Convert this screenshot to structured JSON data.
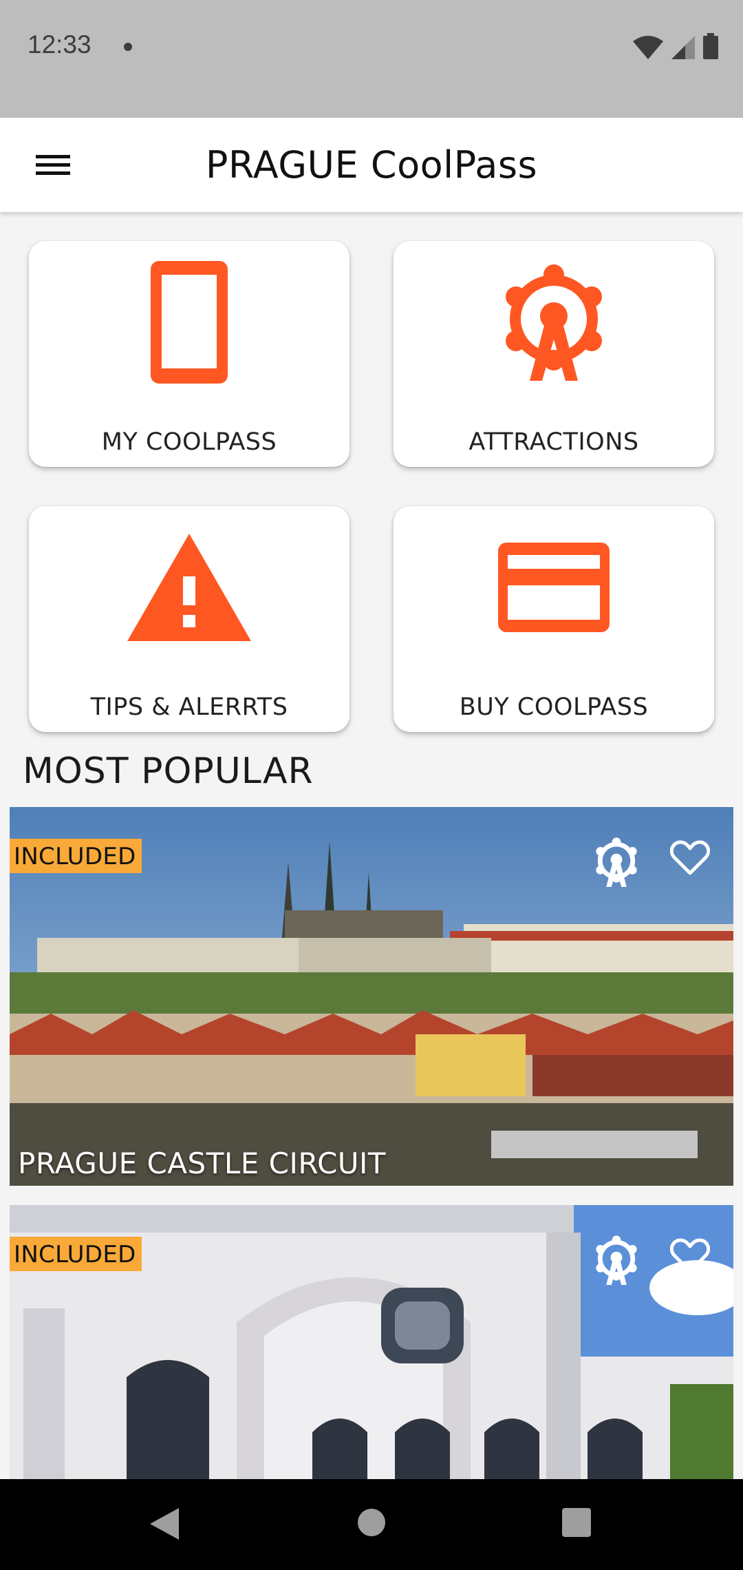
{
  "status_bar": {
    "time": "12:33"
  },
  "app_bar": {
    "title": "PRAGUE CoolPass"
  },
  "tiles": [
    {
      "label": "MY COOLPASS",
      "icon": "phone-icon"
    },
    {
      "label": "ATTRACTIONS",
      "icon": "ferris-wheel-icon"
    },
    {
      "label": "TIPS & ALERRTS",
      "icon": "warning-icon"
    },
    {
      "label": "BUY COOLPASS",
      "icon": "credit-card-icon"
    }
  ],
  "section": {
    "title": "MOST POPULAR"
  },
  "cards": [
    {
      "badge": "INCLUDED",
      "caption": "PRAGUE CASTLE CIRCUIT"
    },
    {
      "badge": "INCLUDED",
      "caption": ""
    }
  ],
  "colors": {
    "accent": "#ff5722",
    "badge": "#f8a938",
    "appbar": "#ffffff",
    "background": "#f4f4f4"
  },
  "nav": {
    "back": "back-icon",
    "home": "home-icon",
    "recents": "recents-icon"
  }
}
